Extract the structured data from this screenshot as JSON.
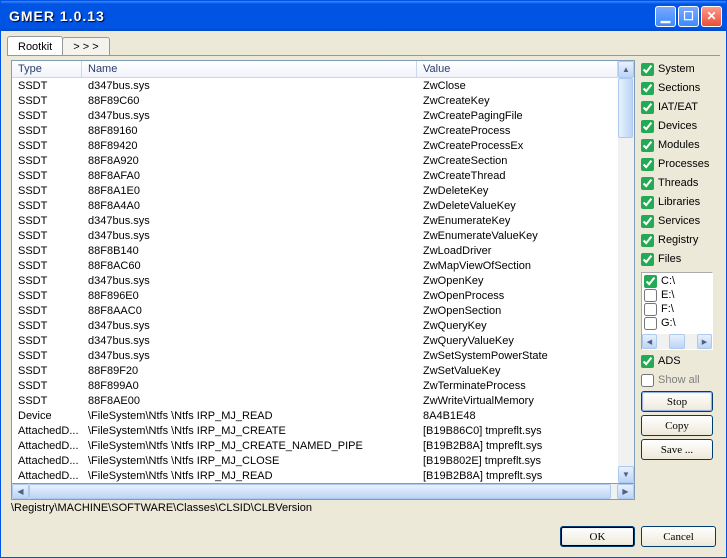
{
  "title": "GMER 1.0.13",
  "tabs": [
    "Rootkit",
    "> > >"
  ],
  "active_tab": 0,
  "columns": [
    "Type",
    "Name",
    "Value"
  ],
  "rows": [
    {
      "t": "SSDT",
      "n": "d347bus.sys",
      "v": "ZwClose"
    },
    {
      "t": "SSDT",
      "n": "88F89C60",
      "v": "ZwCreateKey"
    },
    {
      "t": "SSDT",
      "n": "d347bus.sys",
      "v": "ZwCreatePagingFile"
    },
    {
      "t": "SSDT",
      "n": "88F89160",
      "v": "ZwCreateProcess"
    },
    {
      "t": "SSDT",
      "n": "88F89420",
      "v": "ZwCreateProcessEx"
    },
    {
      "t": "SSDT",
      "n": "88F8A920",
      "v": "ZwCreateSection"
    },
    {
      "t": "SSDT",
      "n": "88F8AFA0",
      "v": "ZwCreateThread"
    },
    {
      "t": "SSDT",
      "n": "88F8A1E0",
      "v": "ZwDeleteKey"
    },
    {
      "t": "SSDT",
      "n": "88F8A4A0",
      "v": "ZwDeleteValueKey"
    },
    {
      "t": "SSDT",
      "n": "d347bus.sys",
      "v": "ZwEnumerateKey"
    },
    {
      "t": "SSDT",
      "n": "d347bus.sys",
      "v": "ZwEnumerateValueKey"
    },
    {
      "t": "SSDT",
      "n": "88F8B140",
      "v": "ZwLoadDriver"
    },
    {
      "t": "SSDT",
      "n": "88F8AC60",
      "v": "ZwMapViewOfSection"
    },
    {
      "t": "SSDT",
      "n": "d347bus.sys",
      "v": "ZwOpenKey"
    },
    {
      "t": "SSDT",
      "n": "88F896E0",
      "v": "ZwOpenProcess"
    },
    {
      "t": "SSDT",
      "n": "88F8AAC0",
      "v": "ZwOpenSection"
    },
    {
      "t": "SSDT",
      "n": "d347bus.sys",
      "v": "ZwQueryKey"
    },
    {
      "t": "SSDT",
      "n": "d347bus.sys",
      "v": "ZwQueryValueKey"
    },
    {
      "t": "SSDT",
      "n": "d347bus.sys",
      "v": "ZwSetSystemPowerState"
    },
    {
      "t": "SSDT",
      "n": "88F89F20",
      "v": "ZwSetValueKey"
    },
    {
      "t": "SSDT",
      "n": "88F899A0",
      "v": "ZwTerminateProcess"
    },
    {
      "t": "SSDT",
      "n": "88F8AE00",
      "v": "ZwWriteVirtualMemory"
    },
    {
      "t": "Device",
      "n": "\\FileSystem\\Ntfs \\Ntfs IRP_MJ_READ",
      "v": "8A4B1E48"
    },
    {
      "t": "AttachedD...",
      "n": "\\FileSystem\\Ntfs \\Ntfs IRP_MJ_CREATE",
      "v": "[B19B86C0] tmpreflt.sys"
    },
    {
      "t": "AttachedD...",
      "n": "\\FileSystem\\Ntfs \\Ntfs IRP_MJ_CREATE_NAMED_PIPE",
      "v": "[B19B2B8A] tmpreflt.sys"
    },
    {
      "t": "AttachedD...",
      "n": "\\FileSystem\\Ntfs \\Ntfs IRP_MJ_CLOSE",
      "v": "[B19B802E] tmpreflt.sys"
    },
    {
      "t": "AttachedD...",
      "n": "\\FileSystem\\Ntfs \\Ntfs IRP_MJ_READ",
      "v": "[B19B2B8A] tmpreflt.sys"
    }
  ],
  "checks": [
    {
      "label": "System",
      "checked": true
    },
    {
      "label": "Sections",
      "checked": true
    },
    {
      "label": "IAT/EAT",
      "checked": true
    },
    {
      "label": "Devices",
      "checked": true
    },
    {
      "label": "Modules",
      "checked": true
    },
    {
      "label": "Processes",
      "checked": true
    },
    {
      "label": "Threads",
      "checked": true
    },
    {
      "label": "Libraries",
      "checked": true
    },
    {
      "label": "Services",
      "checked": true
    },
    {
      "label": "Registry",
      "checked": true
    },
    {
      "label": "Files",
      "checked": true
    }
  ],
  "drives": [
    {
      "label": "C:\\",
      "checked": true
    },
    {
      "label": "E:\\",
      "checked": false
    },
    {
      "label": "F:\\",
      "checked": false
    },
    {
      "label": "G:\\",
      "checked": false
    }
  ],
  "ads": {
    "label": "ADS",
    "checked": true
  },
  "showall": {
    "label": "Show all",
    "checked": false
  },
  "side_buttons": {
    "stop": "Stop",
    "copy": "Copy",
    "save": "Save ..."
  },
  "status": "\\Registry\\MACHINE\\SOFTWARE\\Classes\\CLSID\\CLBVersion",
  "footer": {
    "ok": "OK",
    "cancel": "Cancel"
  }
}
